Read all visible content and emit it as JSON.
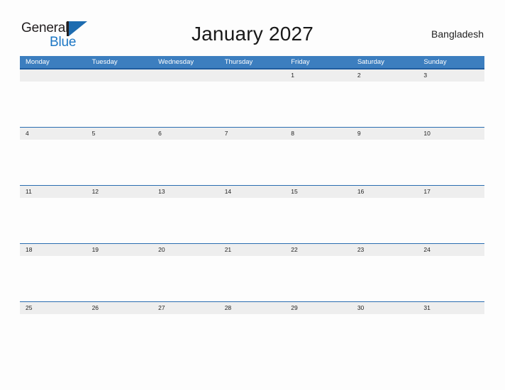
{
  "header": {
    "logo": {
      "word1": "General",
      "word2": "Blue",
      "mark": "flag-triangle"
    },
    "title": "January 2027",
    "country": "Bangladesh"
  },
  "calendar": {
    "weekdays": [
      "Monday",
      "Tuesday",
      "Wednesday",
      "Thursday",
      "Friday",
      "Saturday",
      "Sunday"
    ],
    "weeks": [
      [
        "",
        "",
        "",
        "",
        "1",
        "2",
        "3"
      ],
      [
        "4",
        "5",
        "6",
        "7",
        "8",
        "9",
        "10"
      ],
      [
        "11",
        "12",
        "13",
        "14",
        "15",
        "16",
        "17"
      ],
      [
        "18",
        "19",
        "20",
        "21",
        "22",
        "23",
        "24"
      ],
      [
        "25",
        "26",
        "27",
        "28",
        "29",
        "30",
        "31"
      ]
    ]
  },
  "colors": {
    "header_blue": "#3c7ebf",
    "rule_blue": "#2a6db0",
    "date_band": "#eeeeee",
    "logo_blue": "#1d77c4",
    "page_bg": "#fdfdfd"
  }
}
